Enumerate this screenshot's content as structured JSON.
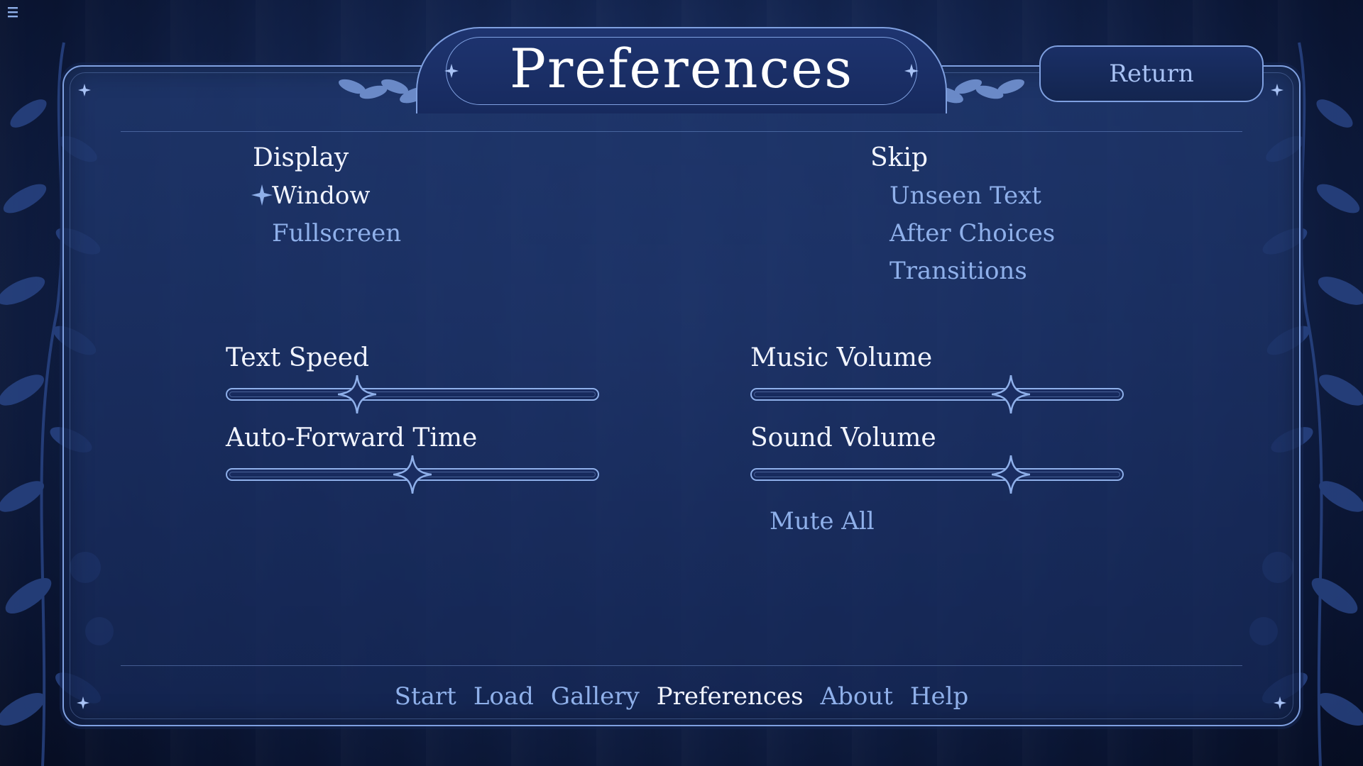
{
  "screen": {
    "title": "Preferences",
    "return_label": "Return",
    "menu_icon": "hamburger-icon"
  },
  "display": {
    "heading": "Display",
    "options": [
      {
        "label": "Window",
        "selected": true
      },
      {
        "label": "Fullscreen",
        "selected": false
      }
    ]
  },
  "skip": {
    "heading": "Skip",
    "options": [
      {
        "label": "Unseen Text",
        "selected": false
      },
      {
        "label": "After Choices",
        "selected": false
      },
      {
        "label": "Transitions",
        "selected": false
      }
    ]
  },
  "sliders": {
    "text_speed": {
      "label": "Text Speed",
      "value": 0.35
    },
    "auto_forward": {
      "label": "Auto-Forward Time",
      "value": 0.5
    },
    "music_volume": {
      "label": "Music Volume",
      "value": 0.7
    },
    "sound_volume": {
      "label": "Sound Volume",
      "value": 0.7
    }
  },
  "mute_all": "Mute All",
  "nav": {
    "items": [
      "Start",
      "Load",
      "Gallery",
      "Preferences",
      "About",
      "Help"
    ],
    "active": "Preferences"
  },
  "colors": {
    "accent": "#8fb0ea",
    "text_active": "#f2f5ff",
    "frame": "#7fa0e0",
    "background": "#142652"
  }
}
